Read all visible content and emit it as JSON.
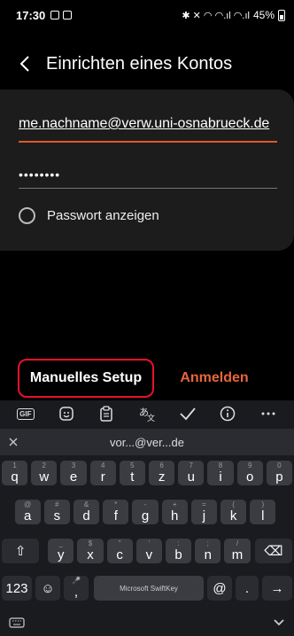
{
  "status": {
    "time": "17:30",
    "battery": "45%",
    "indicators": "✱ ✕ ◠ ◠.ıl ◠.ıl"
  },
  "header": {
    "title": "Einrichten eines Kontos"
  },
  "form": {
    "email": "me.nachname@verw.uni-osnabrueck.de",
    "password_mask": "••••••••",
    "show_password": "Passwort anzeigen"
  },
  "actions": {
    "manual": "Manuelles Setup",
    "login": "Anmelden"
  },
  "keyboard": {
    "toolbar": [
      "GIF",
      "sticker-icon",
      "clipboard-icon",
      "translate-icon",
      "check-icon",
      "info-icon",
      "more-icon"
    ],
    "suggestion": "vor...@ver...de",
    "row1": [
      {
        "k": "q",
        "n": "1"
      },
      {
        "k": "w",
        "n": "2"
      },
      {
        "k": "e",
        "n": "3"
      },
      {
        "k": "r",
        "n": "4"
      },
      {
        "k": "t",
        "n": "5"
      },
      {
        "k": "z",
        "n": "6"
      },
      {
        "k": "u",
        "n": "7"
      },
      {
        "k": "i",
        "n": "8"
      },
      {
        "k": "o",
        "n": "9"
      },
      {
        "k": "p",
        "n": "0"
      }
    ],
    "row2": [
      {
        "k": "a",
        "n": "@"
      },
      {
        "k": "s",
        "n": "#"
      },
      {
        "k": "d",
        "n": "&"
      },
      {
        "k": "f",
        "n": "*"
      },
      {
        "k": "g",
        "n": "-"
      },
      {
        "k": "h",
        "n": "+"
      },
      {
        "k": "j",
        "n": "="
      },
      {
        "k": "k",
        "n": "("
      },
      {
        "k": "l",
        "n": ")"
      }
    ],
    "row3": [
      {
        "k": "y",
        "n": "_"
      },
      {
        "k": "x",
        "n": "$"
      },
      {
        "k": "c",
        "n": "\""
      },
      {
        "k": "v",
        "n": "'"
      },
      {
        "k": "b",
        "n": ":"
      },
      {
        "k": "n",
        "n": ";"
      },
      {
        "k": "m",
        "n": "/"
      }
    ],
    "row4": {
      "num": "123",
      "space": "Microsoft SwiftKey",
      "at": "@",
      "dot": "."
    }
  }
}
